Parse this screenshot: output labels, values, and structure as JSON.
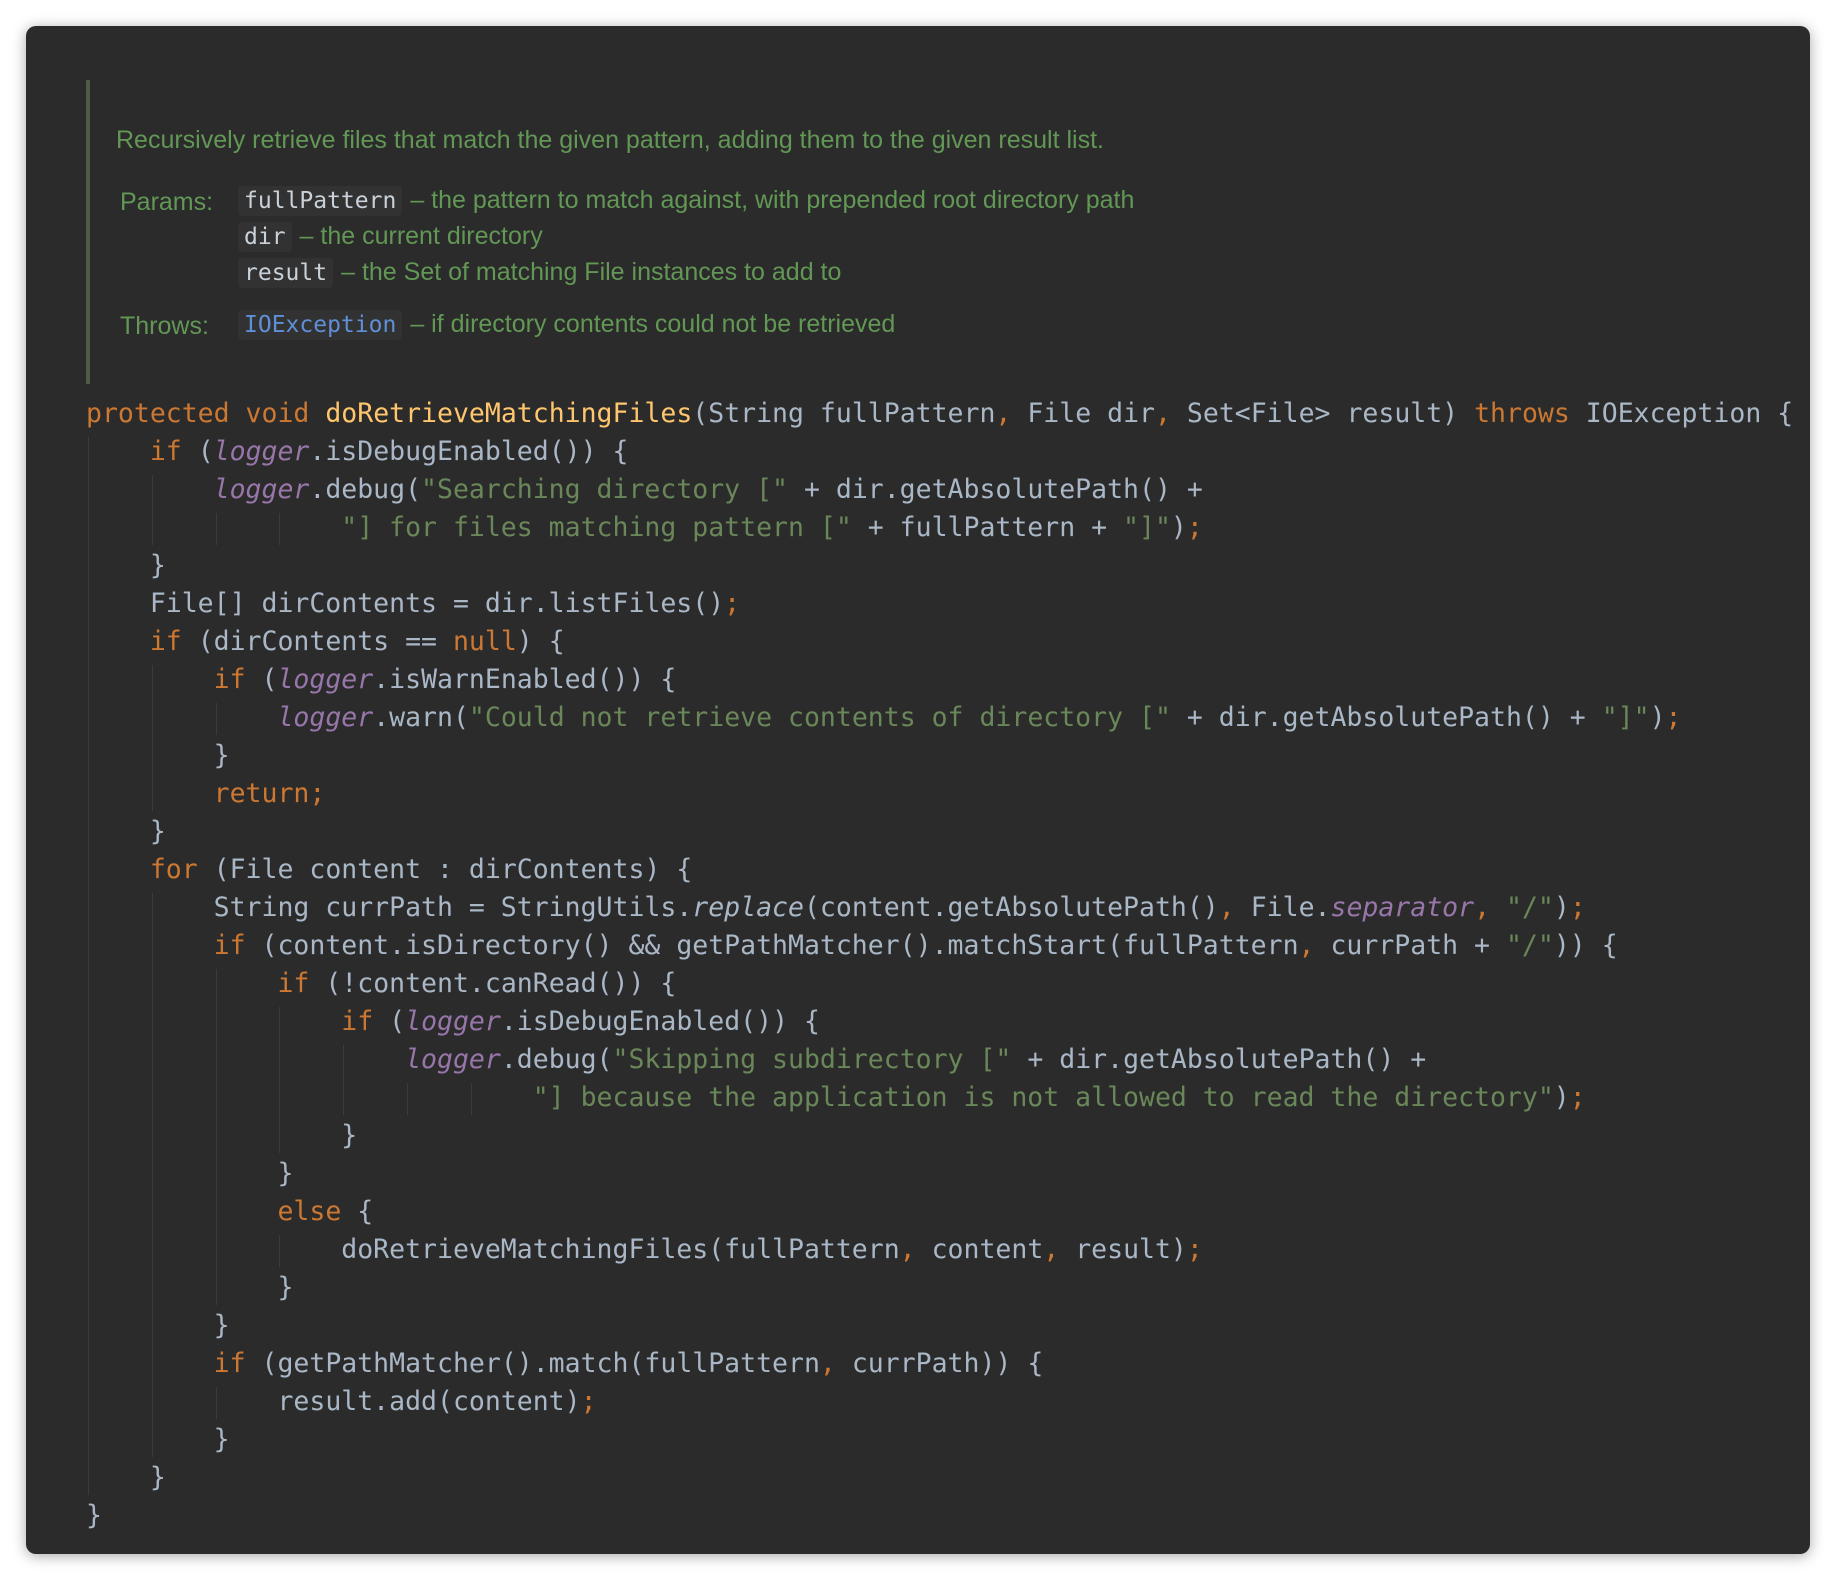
{
  "doc": {
    "summary": "Recursively retrieve files that match the given pattern, adding them to the given result list.",
    "params_label": "Params:",
    "params": [
      {
        "name": "fullPattern",
        "desc": "– the pattern to match against, with prepended root directory path"
      },
      {
        "name": "dir",
        "desc": "– the current directory"
      },
      {
        "name": "result",
        "desc": "– the Set of matching File instances to add to"
      }
    ],
    "throws_label": "Throws:",
    "throws": {
      "name": "IOException",
      "desc": "– if directory contents could not be retrieved"
    }
  },
  "colors": {
    "background": "#2b2b2b",
    "keyword": "#cc7832",
    "method_decl": "#ffc66d",
    "string": "#6a8759",
    "field_italic": "#9876aa",
    "text": "#a9b7c6",
    "doc_text": "#629755",
    "doc_link": "#5f8fd6"
  },
  "code_lines": [
    {
      "indent": 0,
      "tokens": [
        [
          "kw",
          "protected "
        ],
        [
          "kw",
          "void "
        ],
        [
          "fn",
          "doRetrieveMatchingFiles"
        ],
        [
          "p",
          "(String fullPattern"
        ],
        [
          "kw",
          ", "
        ],
        [
          "p",
          "File dir"
        ],
        [
          "kw",
          ", "
        ],
        [
          "p",
          "Set<File> result) "
        ],
        [
          "kw",
          "throws "
        ],
        [
          "p",
          "IOException {"
        ]
      ]
    },
    {
      "indent": 1,
      "tokens": [
        [
          "kw",
          "if "
        ],
        [
          "p",
          "("
        ],
        [
          "it",
          "logger"
        ],
        [
          "p",
          ".isDebugEnabled()) {"
        ]
      ]
    },
    {
      "indent": 2,
      "tokens": [
        [
          "it",
          "logger"
        ],
        [
          "p",
          ".debug("
        ],
        [
          "str",
          "\"Searching directory [\" "
        ],
        [
          "p",
          "+ dir.getAbsolutePath() +"
        ]
      ]
    },
    {
      "indent": 4,
      "tokens": [
        [
          "str",
          "\"] for files matching pattern [\" "
        ],
        [
          "p",
          "+ fullPattern + "
        ],
        [
          "str",
          "\"]\""
        ],
        [
          "p",
          ")"
        ],
        [
          "kw",
          ";"
        ]
      ]
    },
    {
      "indent": 1,
      "tokens": [
        [
          "p",
          "}"
        ]
      ]
    },
    {
      "indent": 1,
      "tokens": [
        [
          "p",
          "File[] dirContents = dir.listFiles()"
        ],
        [
          "kw",
          ";"
        ]
      ]
    },
    {
      "indent": 1,
      "tokens": [
        [
          "kw",
          "if "
        ],
        [
          "p",
          "(dirContents == "
        ],
        [
          "kw",
          "null"
        ],
        [
          "p",
          ") {"
        ]
      ]
    },
    {
      "indent": 2,
      "tokens": [
        [
          "kw",
          "if "
        ],
        [
          "p",
          "("
        ],
        [
          "it",
          "logger"
        ],
        [
          "p",
          ".isWarnEnabled()) {"
        ]
      ]
    },
    {
      "indent": 3,
      "tokens": [
        [
          "it",
          "logger"
        ],
        [
          "p",
          ".warn("
        ],
        [
          "str",
          "\"Could not retrieve contents of directory [\" "
        ],
        [
          "p",
          "+ dir.getAbsolutePath() + "
        ],
        [
          "str",
          "\"]\""
        ],
        [
          "p",
          ")"
        ],
        [
          "kw",
          ";"
        ]
      ]
    },
    {
      "indent": 2,
      "tokens": [
        [
          "p",
          "}"
        ]
      ]
    },
    {
      "indent": 2,
      "tokens": [
        [
          "kw",
          "return;"
        ]
      ]
    },
    {
      "indent": 1,
      "tokens": [
        [
          "p",
          "}"
        ]
      ]
    },
    {
      "indent": 1,
      "tokens": [
        [
          "kw",
          "for "
        ],
        [
          "p",
          "(File content : dirContents) {"
        ]
      ]
    },
    {
      "indent": 2,
      "tokens": [
        [
          "p",
          "String currPath = StringUtils."
        ],
        [
          "itp",
          "replace"
        ],
        [
          "p",
          "(content.getAbsolutePath()"
        ],
        [
          "kw",
          ", "
        ],
        [
          "p",
          "File."
        ],
        [
          "it",
          "separator"
        ],
        [
          "kw",
          ", "
        ],
        [
          "str",
          "\"/\""
        ],
        [
          "p",
          ")"
        ],
        [
          "kw",
          ";"
        ]
      ]
    },
    {
      "indent": 2,
      "tokens": [
        [
          "kw",
          "if "
        ],
        [
          "p",
          "(content.isDirectory() && getPathMatcher().matchStart(fullPattern"
        ],
        [
          "kw",
          ", "
        ],
        [
          "p",
          "currPath + "
        ],
        [
          "str",
          "\"/\""
        ],
        [
          "p",
          ")) {"
        ]
      ]
    },
    {
      "indent": 3,
      "tokens": [
        [
          "kw",
          "if "
        ],
        [
          "p",
          "(!content.canRead()) {"
        ]
      ]
    },
    {
      "indent": 4,
      "tokens": [
        [
          "kw",
          "if "
        ],
        [
          "p",
          "("
        ],
        [
          "it",
          "logger"
        ],
        [
          "p",
          ".isDebugEnabled()) {"
        ]
      ]
    },
    {
      "indent": 5,
      "tokens": [
        [
          "it",
          "logger"
        ],
        [
          "p",
          ".debug("
        ],
        [
          "str",
          "\"Skipping subdirectory [\" "
        ],
        [
          "p",
          "+ dir.getAbsolutePath() +"
        ]
      ]
    },
    {
      "indent": 7,
      "tokens": [
        [
          "str",
          "\"] because the application is not allowed to read the directory\""
        ],
        [
          "p",
          ")"
        ],
        [
          "kw",
          ";"
        ]
      ]
    },
    {
      "indent": 4,
      "tokens": [
        [
          "p",
          "}"
        ]
      ]
    },
    {
      "indent": 3,
      "tokens": [
        [
          "p",
          "}"
        ]
      ]
    },
    {
      "indent": 3,
      "tokens": [
        [
          "kw",
          "else "
        ],
        [
          "p",
          "{"
        ]
      ]
    },
    {
      "indent": 4,
      "tokens": [
        [
          "p",
          "doRetrieveMatchingFiles(fullPattern"
        ],
        [
          "kw",
          ", "
        ],
        [
          "p",
          "content"
        ],
        [
          "kw",
          ", "
        ],
        [
          "p",
          "result)"
        ],
        [
          "kw",
          ";"
        ]
      ]
    },
    {
      "indent": 3,
      "tokens": [
        [
          "p",
          "}"
        ]
      ]
    },
    {
      "indent": 2,
      "tokens": [
        [
          "p",
          "}"
        ]
      ]
    },
    {
      "indent": 2,
      "tokens": [
        [
          "kw",
          "if "
        ],
        [
          "p",
          "(getPathMatcher().match(fullPattern"
        ],
        [
          "kw",
          ", "
        ],
        [
          "p",
          "currPath)) {"
        ]
      ]
    },
    {
      "indent": 3,
      "tokens": [
        [
          "p",
          "result.add(content)"
        ],
        [
          "kw",
          ";"
        ]
      ]
    },
    {
      "indent": 2,
      "tokens": [
        [
          "p",
          "}"
        ]
      ]
    },
    {
      "indent": 1,
      "tokens": [
        [
          "p",
          "}"
        ]
      ]
    },
    {
      "indent": 0,
      "tokens": [
        [
          "p",
          "}"
        ]
      ]
    }
  ]
}
